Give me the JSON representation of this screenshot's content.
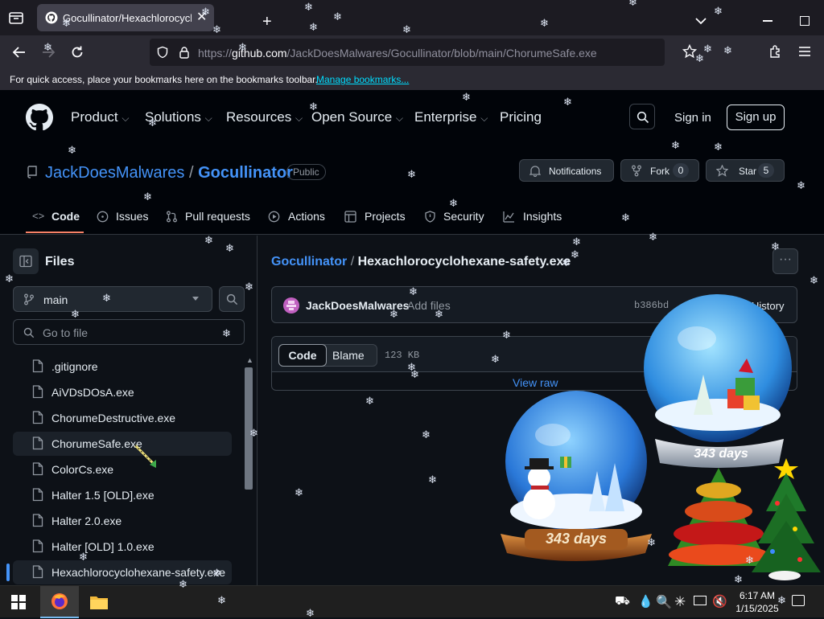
{
  "browser": {
    "tab_title": "Gocullinator/Hexachlorocyclohe",
    "url_prefix": "https://",
    "url_host_part": "github.com",
    "url_path": "/JackDoesMalwares/Gocullinator/blob/main/ChorumeSafe.exe",
    "bookmarks_text": "For quick access, place your bookmarks here on the bookmarks toolbar.",
    "bookmarks_link": "Manage bookmarks..."
  },
  "header": {
    "nav": [
      "Product",
      "Solutions",
      "Resources",
      "Open Source",
      "Enterprise",
      "Pricing"
    ],
    "sign_in": "Sign in",
    "sign_up": "Sign up"
  },
  "repo": {
    "owner": "JackDoesMalwares",
    "separator": "/",
    "name": "Gocullinator",
    "visibility": "Public",
    "notifications": "Notifications",
    "fork_label": "Fork",
    "fork_count": "0",
    "star_label": "Star",
    "star_count": "5",
    "tabs": [
      "Code",
      "Issues",
      "Pull requests",
      "Actions",
      "Projects",
      "Security",
      "Insights"
    ]
  },
  "sidebar": {
    "title": "Files",
    "branch": "main",
    "search_placeholder": "Go to file",
    "files": [
      ".gitignore",
      "AiVDsDOsA.exe",
      "ChorumeDestructive.exe",
      "ChorumeSafe.exe",
      "ColorCs.exe",
      "Halter 1.5 [OLD].exe",
      "Halter 2.0.exe",
      "Halter [OLD] 1.0.exe",
      "Hexachlorocyclohexane-safety.exe"
    ]
  },
  "main": {
    "crumb_repo": "Gocullinator",
    "crumb_sep": "/",
    "crumb_file": "Hexachlorocyclohexane-safety.exe",
    "commit_author": "JackDoesMalwares",
    "commit_msg": "Add files",
    "commit_hash": "b386bd",
    "history": "History",
    "code_tab": "Code",
    "blame_tab": "Blame",
    "size": "123 KB",
    "view_raw": "View raw",
    "globe_days_1": "343 days",
    "globe_days_2": "343 days"
  },
  "taskbar": {
    "time": "6:17 AM",
    "date": "1/15/2025"
  },
  "colors": {
    "link": "#4493f8",
    "bg": "#0d1117",
    "header_bg": "#010409",
    "border": "#30363d"
  }
}
